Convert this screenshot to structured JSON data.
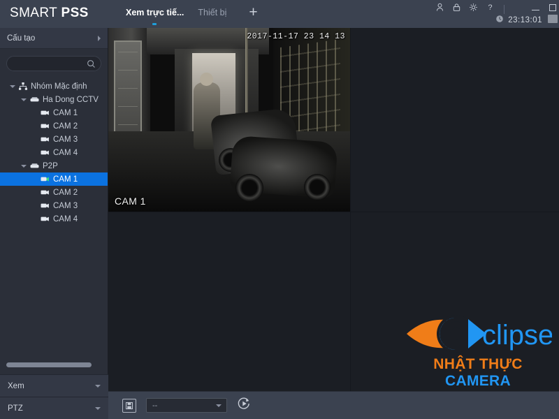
{
  "app": {
    "brand_light": "SMART ",
    "brand_bold": "PSS"
  },
  "titlebar": {
    "tabs": [
      {
        "label": "Xem trực tiế...",
        "active": true
      },
      {
        "label": "Thiết bị",
        "active": false
      }
    ],
    "add_tab_label": "+",
    "icons": [
      "user-icon",
      "lock-icon",
      "gear-icon",
      "help-icon"
    ],
    "window_controls": [
      "minimize-button",
      "maximize-button"
    ],
    "clock": "23:13:01",
    "clock_icon": "clock-icon"
  },
  "sidebar": {
    "header": {
      "title": "Cấu tạo",
      "expander_icon": "chevron-right-icon"
    },
    "search": {
      "value": "",
      "placeholder": "",
      "icon": "search-icon"
    },
    "tree": [
      {
        "label": "Nhóm Mặc định",
        "level": 0,
        "icon": "group-icon",
        "expanded": true,
        "selected": false
      },
      {
        "label": "Ha Dong CCTV",
        "level": 1,
        "icon": "device-icon",
        "expanded": true,
        "selected": false
      },
      {
        "label": "CAM 1",
        "level": 2,
        "icon": "camera-icon",
        "selected": false
      },
      {
        "label": "CAM 2",
        "level": 2,
        "icon": "camera-icon",
        "selected": false
      },
      {
        "label": "CAM 3",
        "level": 2,
        "icon": "camera-icon",
        "selected": false
      },
      {
        "label": "CAM 4",
        "level": 2,
        "icon": "camera-icon",
        "selected": false
      },
      {
        "label": "P2P",
        "level": 1,
        "icon": "device-icon",
        "expanded": true,
        "selected": false
      },
      {
        "label": "CAM 1",
        "level": 2,
        "icon": "camera-icon",
        "selected": true
      },
      {
        "label": "CAM 2",
        "level": 2,
        "icon": "camera-icon",
        "selected": false
      },
      {
        "label": "CAM 3",
        "level": 2,
        "icon": "camera-icon",
        "selected": false
      },
      {
        "label": "CAM 4",
        "level": 2,
        "icon": "camera-icon",
        "selected": false
      }
    ],
    "sections": [
      {
        "title": "Xem",
        "icon": "chevron-down-icon"
      },
      {
        "title": "PTZ",
        "icon": "chevron-down-icon"
      }
    ],
    "scrollbar": "horizontal-scrollbar"
  },
  "stage": {
    "layout": "2x2",
    "cells": [
      {
        "position": "top-left",
        "active": true,
        "channel_name": "CAM 1",
        "timestamp": "2017-11-17 23 14 13"
      },
      {
        "position": "top-right",
        "active": false
      },
      {
        "position": "bottom-left",
        "active": false
      },
      {
        "position": "bottom-right",
        "active": false
      }
    ],
    "watermark": {
      "brand_part1": "e",
      "brand_part2": "clipse",
      "sub_part1": "NHẬT THỰC ",
      "sub_part2": "CAMERA"
    }
  },
  "bottombar": {
    "snapshot_icon": "snapshot-icon",
    "select_value": "--",
    "select_caret": "chevron-down-icon",
    "refresh_icon": "play-refresh-icon"
  },
  "colors": {
    "accent_selected": "#0b72e0",
    "titlebar_bg": "#3b4250",
    "sidebar_bg": "#2b2f39",
    "stage_bg": "#1b1e24",
    "tab_indicator": "#1f9ed9",
    "watermark_orange": "#f07d18",
    "watermark_blue": "#2196f3"
  }
}
